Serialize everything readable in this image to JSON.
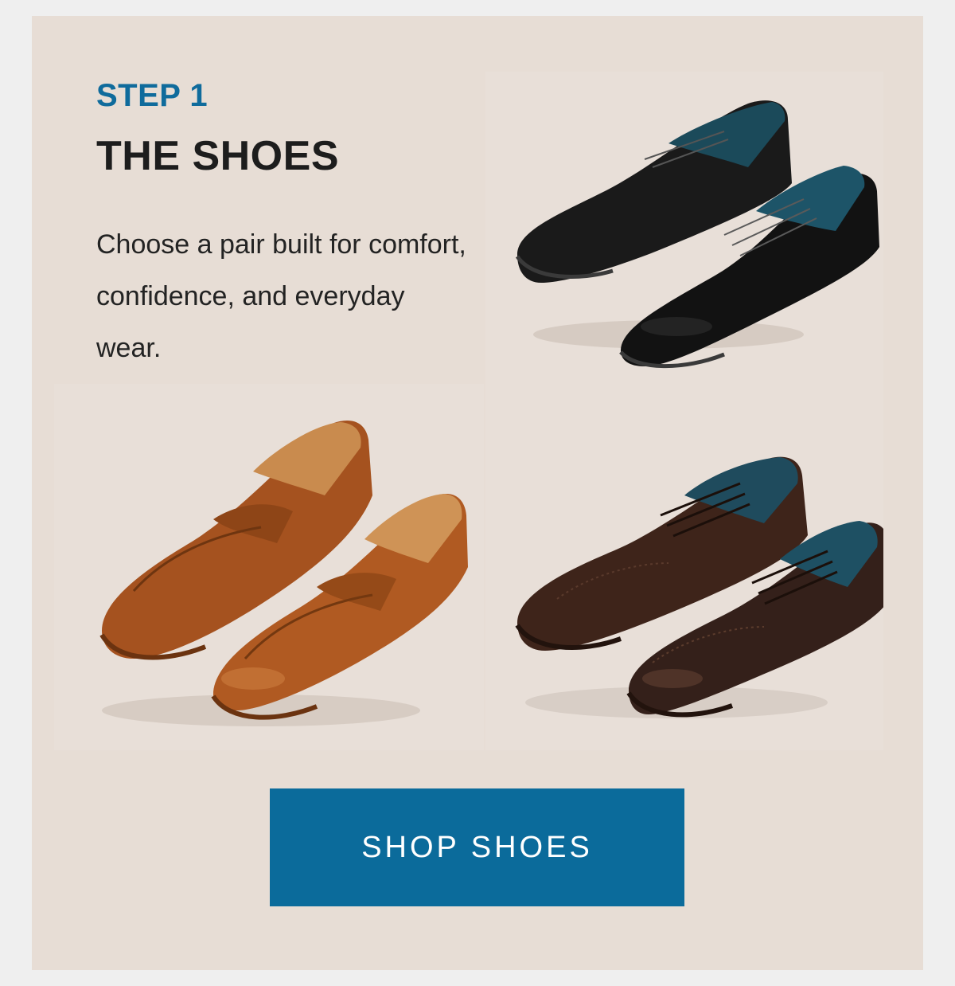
{
  "section": {
    "step_label": "STEP 1",
    "title": "THE SHOES",
    "description": "Choose a pair built for comfort, confidence, and everyday wear."
  },
  "products": [
    {
      "name": "black-wingtip-derby",
      "icon": "black-wingtip-shoes-image",
      "color": "#161616"
    },
    {
      "name": "tan-penny-loafer",
      "icon": "tan-loafer-shoes-image",
      "color": "#a5521f"
    },
    {
      "name": "brown-wingtip-oxford",
      "icon": "brown-wingtip-shoes-image",
      "color": "#3b2219"
    }
  ],
  "cta": {
    "label": "SHOP SHOES",
    "color": "#0b6b9b"
  },
  "colors": {
    "background": "#e7ddd5",
    "accent": "#0f6b9c",
    "text": "#1d1d1d"
  }
}
